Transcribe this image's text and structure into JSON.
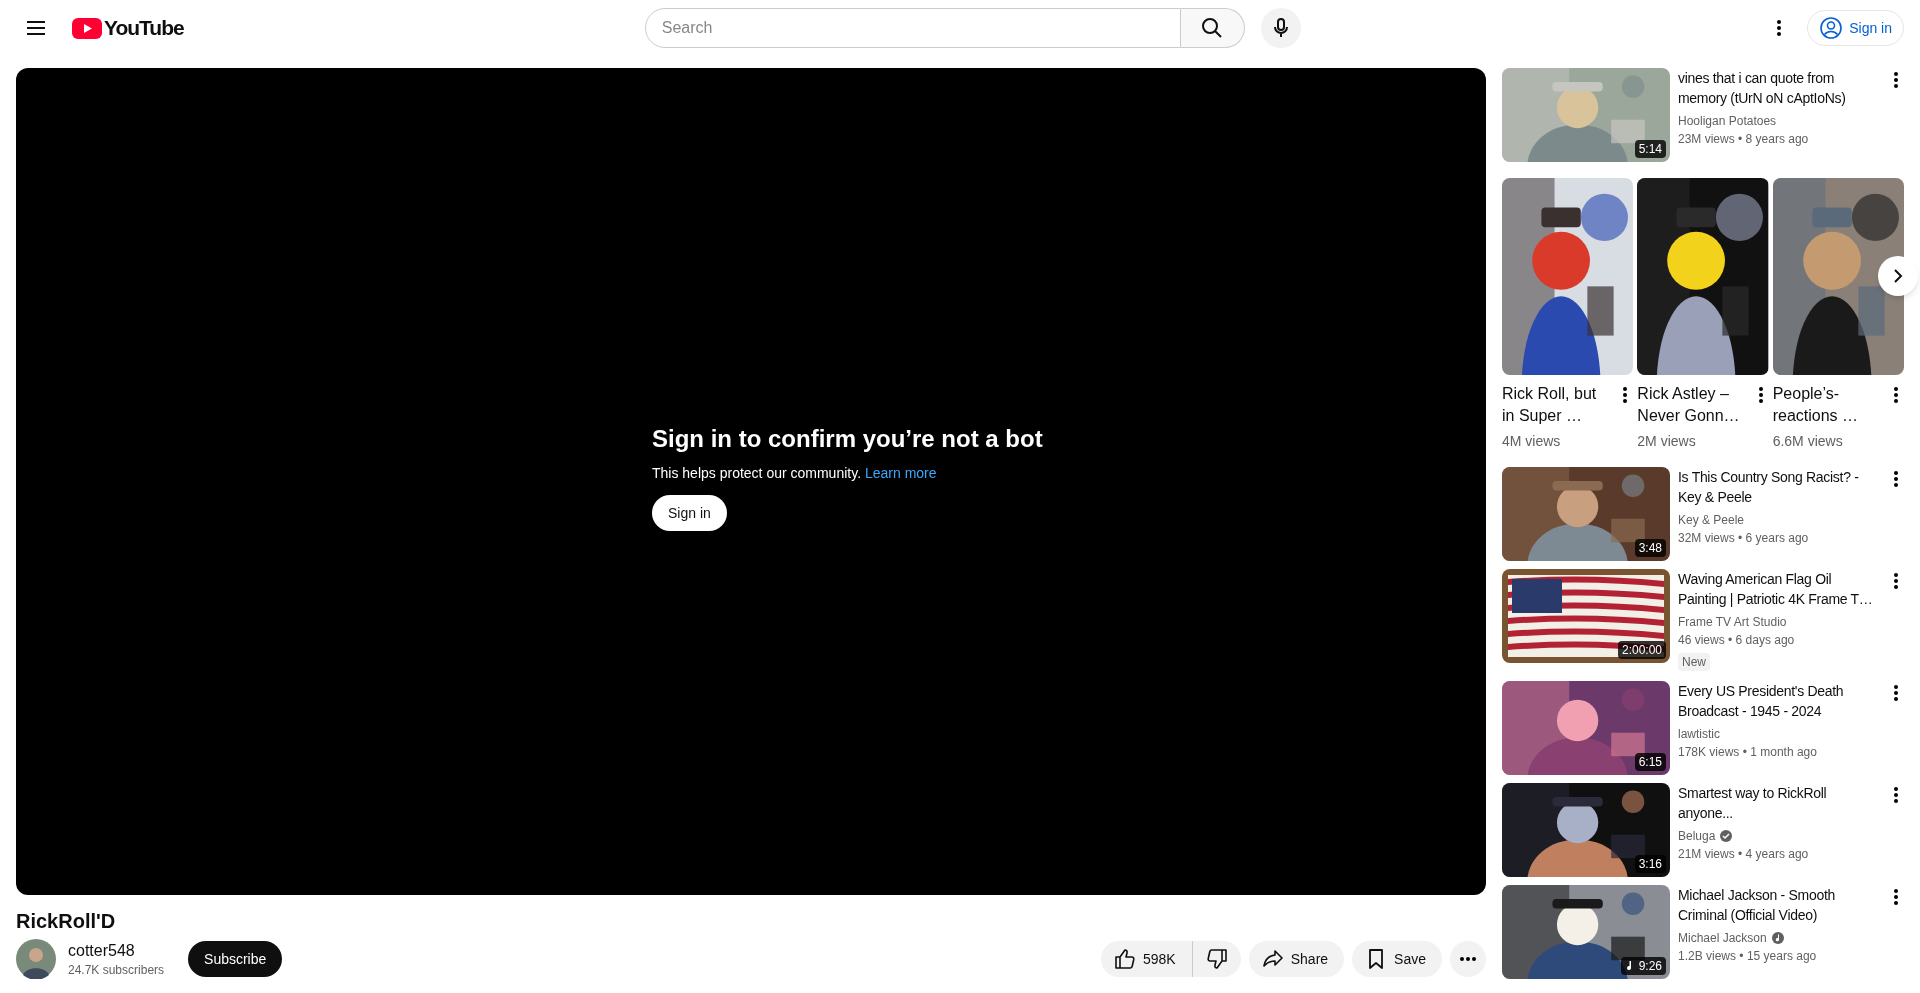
{
  "header": {
    "logo": "YouTube",
    "search_placeholder": "Search",
    "sign_in": "Sign in"
  },
  "player": {
    "heading": "Sign in to confirm you’re not a bot",
    "message": "This helps protect our community.",
    "link": "Learn more",
    "button": "Sign in"
  },
  "video": {
    "title": "RickRoll'D",
    "channel": "cotter548",
    "subscribers": "24.7K subscribers",
    "subscribe": "Subscribe",
    "likes": "598K",
    "share": "Share",
    "save": "Save"
  },
  "sidebar": {
    "top_videos": [
      {
        "title": "vines that i can quote from memory (tUrN oN cAptIoNs)",
        "channel": "Hooligan Potatoes",
        "verified": false,
        "music_artist": false,
        "meta": "23M views • 8 years ago",
        "duration": "5:14",
        "music_duration": false
      }
    ],
    "shorts": [
      {
        "title": "Rick Roll, but in Super …",
        "views": "4M views"
      },
      {
        "title": "Rick Astley – Never Gonn…",
        "views": "2M views"
      },
      {
        "title": "People’s-reactions …",
        "views": "6.6M views"
      }
    ],
    "videos": [
      {
        "title": "Is This Country Song Racist? - Key & Peele",
        "channel": "Key & Peele",
        "verified": false,
        "music_artist": false,
        "meta": "32M views • 6 years ago",
        "duration": "3:48",
        "music_duration": false
      },
      {
        "title": "Waving American Flag Oil Painting | Patriotic 4K Frame T…",
        "channel": "Frame TV Art Studio",
        "verified": false,
        "music_artist": false,
        "meta": "46 views • 6 days ago",
        "duration": "2:00:00",
        "music_duration": false,
        "badge": "New"
      },
      {
        "title": "Every US President's Death Broadcast - 1945 - 2024",
        "channel": "lawtistic",
        "verified": false,
        "music_artist": false,
        "meta": "178K views • 1 month ago",
        "duration": "6:15",
        "music_duration": false
      },
      {
        "title": "Smartest way to RickRoll anyone...",
        "channel": "Beluga",
        "verified": true,
        "music_artist": false,
        "meta": "21M views • 4 years ago",
        "duration": "3:16",
        "music_duration": false
      },
      {
        "title": "Michael Jackson - Smooth Criminal (Official Video)",
        "channel": "Michael Jackson",
        "verified": false,
        "music_artist": true,
        "meta": "1.2B views • 15 years ago",
        "duration": "9:26",
        "music_duration": true
      }
    ]
  }
}
